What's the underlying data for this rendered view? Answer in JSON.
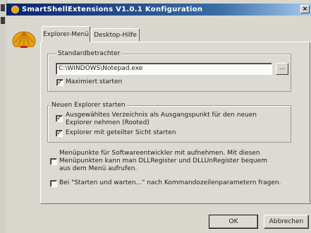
{
  "window": {
    "title": "SmartShellExtensions V1.0.1 Konfiguration",
    "close_glyph": "×"
  },
  "tabs": [
    {
      "label": "Explorer-Menü",
      "active": true
    },
    {
      "label": "Desktop-Hilfe",
      "active": false
    }
  ],
  "standardbetrachter": {
    "group_label": "Standardbetrachter",
    "path_value": "C:\\WINDOWS\\Notepad.exe",
    "browse_label": "...",
    "maximize": {
      "label": "Maximiert starten",
      "checked": true
    }
  },
  "neuer_explorer": {
    "group_label": "Neuen Explorer starten",
    "options": [
      {
        "label": "Ausgewähltes Verzeichnis als Ausgangspunkt für den neuen Explorer nehmen (Rooted)",
        "checked": true
      },
      {
        "label": "Explorer mit geteilter Sicht starten",
        "checked": true
      }
    ]
  },
  "extra_options": [
    {
      "label": "Menüpunkte für Softwareentwickler mit aufnehmen. Mit diesen Menüpunkten kann man DLLRegister und DLLUnRegister bequem aus dem Menü aufrufen.",
      "checked": false
    },
    {
      "label": "Bei \"Starten und warten...\" nach Kommandozeilenparametern fragen.",
      "checked": false
    }
  ],
  "buttons": {
    "ok": "OK",
    "cancel": "Abbrechen"
  },
  "check_glyph": "✓",
  "colors": {
    "title_start": "#0a246a",
    "title_end": "#a6caf0",
    "face": "#d9d7ce",
    "logo": "#e8a010"
  }
}
